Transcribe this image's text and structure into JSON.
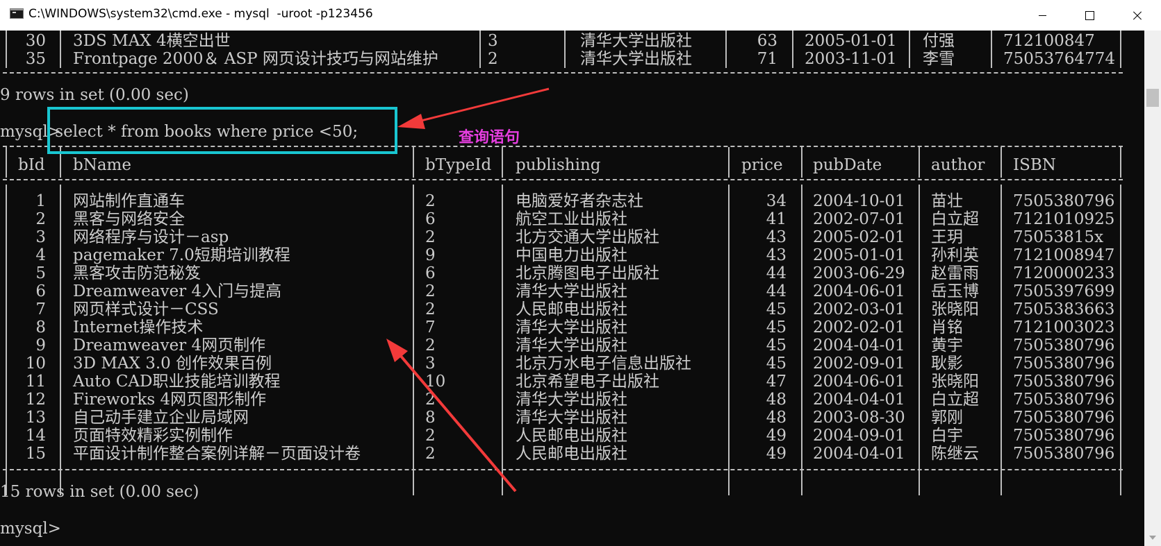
{
  "window": {
    "title": "C:\\WINDOWS\\system32\\cmd.exe - mysql  -uroot -p123456",
    "minimize_icon": "minimize-icon",
    "maximize_icon": "maximize-icon",
    "close_icon": "close-icon"
  },
  "prev_rows": [
    {
      "bId": "30",
      "bName": "3DS MAX 4横空出世",
      "bTypeId": "3",
      "publishing": "清华大学出版社",
      "price": "63",
      "pubDate": "2005-01-01",
      "author": "付强",
      "ISBN": "712100847"
    },
    {
      "bId": "35",
      "bName": "Frontpage 2000＆ ASP 网页设计技巧与网站维护",
      "bTypeId": "2",
      "publishing": "清华大学出版社",
      "price": "71",
      "pubDate": "2003-11-01",
      "author": "李雪",
      "ISBN": "75053764774"
    }
  ],
  "prev_result": "9 rows in set (0.00 sec)",
  "prompt": "mysql>",
  "query": " select * from books where price <50;",
  "annotation_label": "查询语句",
  "columns": [
    "bId",
    "bName",
    "bTypeId",
    "publishing",
    "price",
    "pubDate",
    "author",
    "ISBN"
  ],
  "rows": [
    {
      "bId": "1",
      "bName": "网站制作直通车",
      "bTypeId": "2",
      "publishing": "电脑爱好者杂志社",
      "price": "34",
      "pubDate": "2004-10-01",
      "author": "苗壮",
      "ISBN": "7505380796"
    },
    {
      "bId": "2",
      "bName": "黑客与网络安全",
      "bTypeId": "6",
      "publishing": "航空工业出版社",
      "price": "41",
      "pubDate": "2002-07-01",
      "author": "白立超",
      "ISBN": "7121010925"
    },
    {
      "bId": "3",
      "bName": "网络程序与设计－asp",
      "bTypeId": "2",
      "publishing": "北方交通大学出版社",
      "price": "43",
      "pubDate": "2005-02-01",
      "author": "王玥",
      "ISBN": "75053815x"
    },
    {
      "bId": "4",
      "bName": "pagemaker 7.0短期培训教程",
      "bTypeId": "9",
      "publishing": "中国电力出版社",
      "price": "43",
      "pubDate": "2005-01-01",
      "author": "孙利英",
      "ISBN": "7121008947"
    },
    {
      "bId": "5",
      "bName": "黑客攻击防范秘笈",
      "bTypeId": "6",
      "publishing": "北京腾图电子出版社",
      "price": "44",
      "pubDate": "2003-06-29",
      "author": "赵雷雨",
      "ISBN": "7120000233"
    },
    {
      "bId": "6",
      "bName": "Dreamweaver 4入门与提高",
      "bTypeId": "2",
      "publishing": "清华大学出版社",
      "price": "44",
      "pubDate": "2004-06-01",
      "author": "岳玉博",
      "ISBN": "7505397699"
    },
    {
      "bId": "7",
      "bName": "网页样式设计－CSS",
      "bTypeId": "2",
      "publishing": "人民邮电出版社",
      "price": "45",
      "pubDate": "2002-03-01",
      "author": "张晓阳",
      "ISBN": "7505383663"
    },
    {
      "bId": "8",
      "bName": "Internet操作技术",
      "bTypeId": "7",
      "publishing": "清华大学出版社",
      "price": "45",
      "pubDate": "2002-02-01",
      "author": "肖铭",
      "ISBN": "7121003023"
    },
    {
      "bId": "9",
      "bName": "Dreamweaver 4网页制作",
      "bTypeId": "2",
      "publishing": "清华大学出版社",
      "price": "45",
      "pubDate": "2004-04-01",
      "author": "黄宇",
      "ISBN": "7505380796"
    },
    {
      "bId": "10",
      "bName": "3D MAX 3.0 创作效果百例",
      "bTypeId": "3",
      "publishing": "北京万水电子信息出版社",
      "price": "45",
      "pubDate": "2002-09-01",
      "author": "耿影",
      "ISBN": "7505380796"
    },
    {
      "bId": "11",
      "bName": "Auto CAD职业技能培训教程",
      "bTypeId": "10",
      "publishing": "北京希望电子出版社",
      "price": "47",
      "pubDate": "2004-06-01",
      "author": "张晓阳",
      "ISBN": "7505380796"
    },
    {
      "bId": "12",
      "bName": "Fireworks 4网页图形制作",
      "bTypeId": "2",
      "publishing": "清华大学出版社",
      "price": "48",
      "pubDate": "2004-04-01",
      "author": "白立超",
      "ISBN": "7505380796"
    },
    {
      "bId": "13",
      "bName": "自己动手建立企业局域网",
      "bTypeId": "8",
      "publishing": "清华大学出版社",
      "price": "48",
      "pubDate": "2003-08-30",
      "author": "郭刚",
      "ISBN": "7505380796"
    },
    {
      "bId": "14",
      "bName": "页面特效精彩实例制作",
      "bTypeId": "2",
      "publishing": "人民邮电出版社",
      "price": "49",
      "pubDate": "2004-09-01",
      "author": "白宇",
      "ISBN": "7505380796"
    },
    {
      "bId": "15",
      "bName": "平面设计制作整合案例详解－页面设计卷",
      "bTypeId": "2",
      "publishing": "人民邮电出版社",
      "price": "49",
      "pubDate": "2004-04-01",
      "author": "陈继云",
      "ISBN": "7505380796"
    }
  ],
  "result": "15 rows in set (0.00 sec)",
  "colors": {
    "console_bg": "#0c0c0c",
    "console_text": "#cccccc",
    "highlight_box": "#19c6d1",
    "annotation_text": "#e63ee0",
    "arrow": "#f23a3a"
  }
}
